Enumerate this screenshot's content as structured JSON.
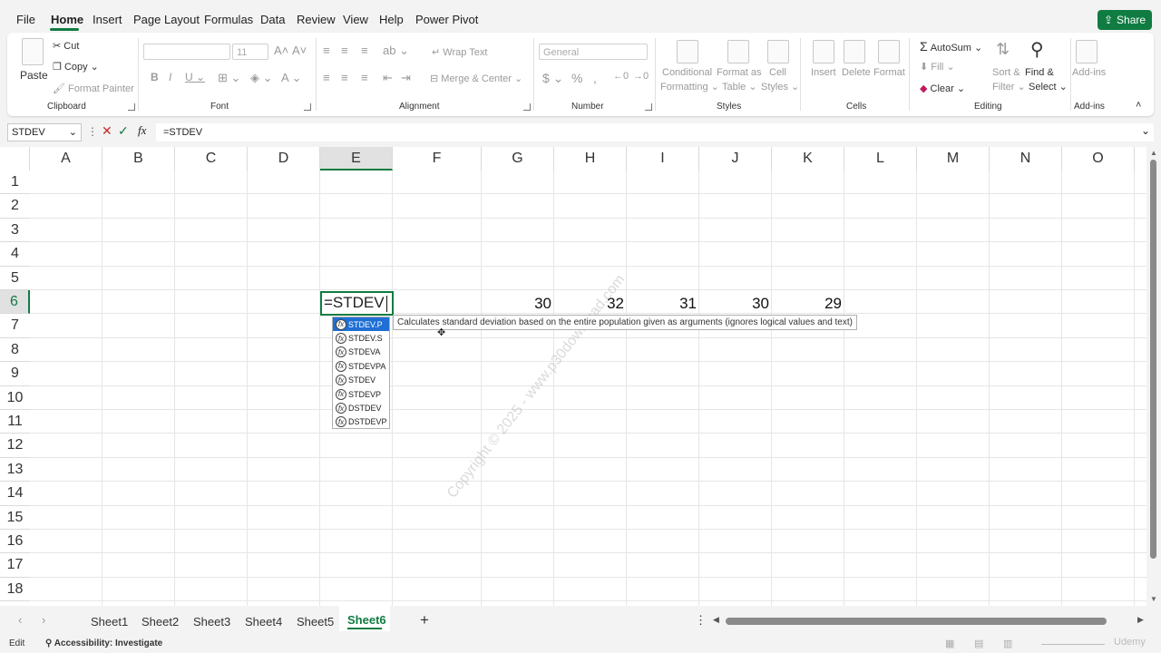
{
  "menu": {
    "tabs": [
      "File",
      "Home",
      "Insert",
      "Page Layout",
      "Formulas",
      "Data",
      "Review",
      "View",
      "Help",
      "Power Pivot"
    ],
    "share": "Share"
  },
  "ribbon": {
    "clipboard": {
      "paste": "Paste",
      "cut": "Cut",
      "copy": "Copy",
      "format_painter": "Format Painter",
      "label": "Clipboard"
    },
    "font": {
      "font_size": "11",
      "label": "Font"
    },
    "alignment": {
      "wrap_text": "Wrap Text",
      "merge_center": "Merge & Center",
      "label": "Alignment"
    },
    "number": {
      "format": "General",
      "label": "Number"
    },
    "styles": {
      "conditional": "Conditional",
      "formatting": "Formatting",
      "format_as": "Format as",
      "table": "Table",
      "cell": "Cell",
      "styles": "Styles",
      "label": "Styles"
    },
    "cells": {
      "insert": "Insert",
      "delete": "Delete",
      "format": "Format",
      "label": "Cells"
    },
    "editing": {
      "autosum": "AutoSum",
      "fill": "Fill",
      "clear": "Clear",
      "sort": "Sort &",
      "filter": "Filter",
      "find": "Find &",
      "select": "Select",
      "label": "Editing"
    },
    "addins": {
      "addins": "Add-ins",
      "label": "Add-ins"
    }
  },
  "formula_bar": {
    "name_box": "STDEV",
    "fx": "fx",
    "formula": "=STDEV"
  },
  "grid": {
    "columns": [
      "A",
      "B",
      "C",
      "D",
      "E",
      "F",
      "G",
      "H",
      "I",
      "J",
      "K",
      "L",
      "M",
      "N",
      "O"
    ],
    "rows": [
      "1",
      "2",
      "3",
      "4",
      "5",
      "6",
      "7",
      "8",
      "9",
      "10",
      "11",
      "12",
      "13",
      "14",
      "15",
      "16",
      "17",
      "18"
    ],
    "active_cell_text": "=STDEV",
    "row6_values": {
      "G": "30",
      "H": "32",
      "I": "31",
      "J": "30",
      "K": "29"
    }
  },
  "autocomplete": {
    "items": [
      "STDEV.P",
      "STDEV.S",
      "STDEVA",
      "STDEVPA",
      "STDEV",
      "STDEVP",
      "DSTDEV",
      "DSTDEVP"
    ],
    "tooltip": "Calculates standard deviation based on the entire population given as arguments (ignores logical values and text)"
  },
  "watermark": "Copyright © 2025 - www.p30download.com",
  "sheets": [
    "Sheet1",
    "Sheet2",
    "Sheet3",
    "Sheet4",
    "Sheet5",
    "Sheet6"
  ],
  "status": {
    "mode": "Edit",
    "accessibility": "Accessibility: Investigate",
    "udemy": "Udemy"
  },
  "colors": {
    "accent": "#107c41",
    "ac_select": "#1f6fd4"
  }
}
